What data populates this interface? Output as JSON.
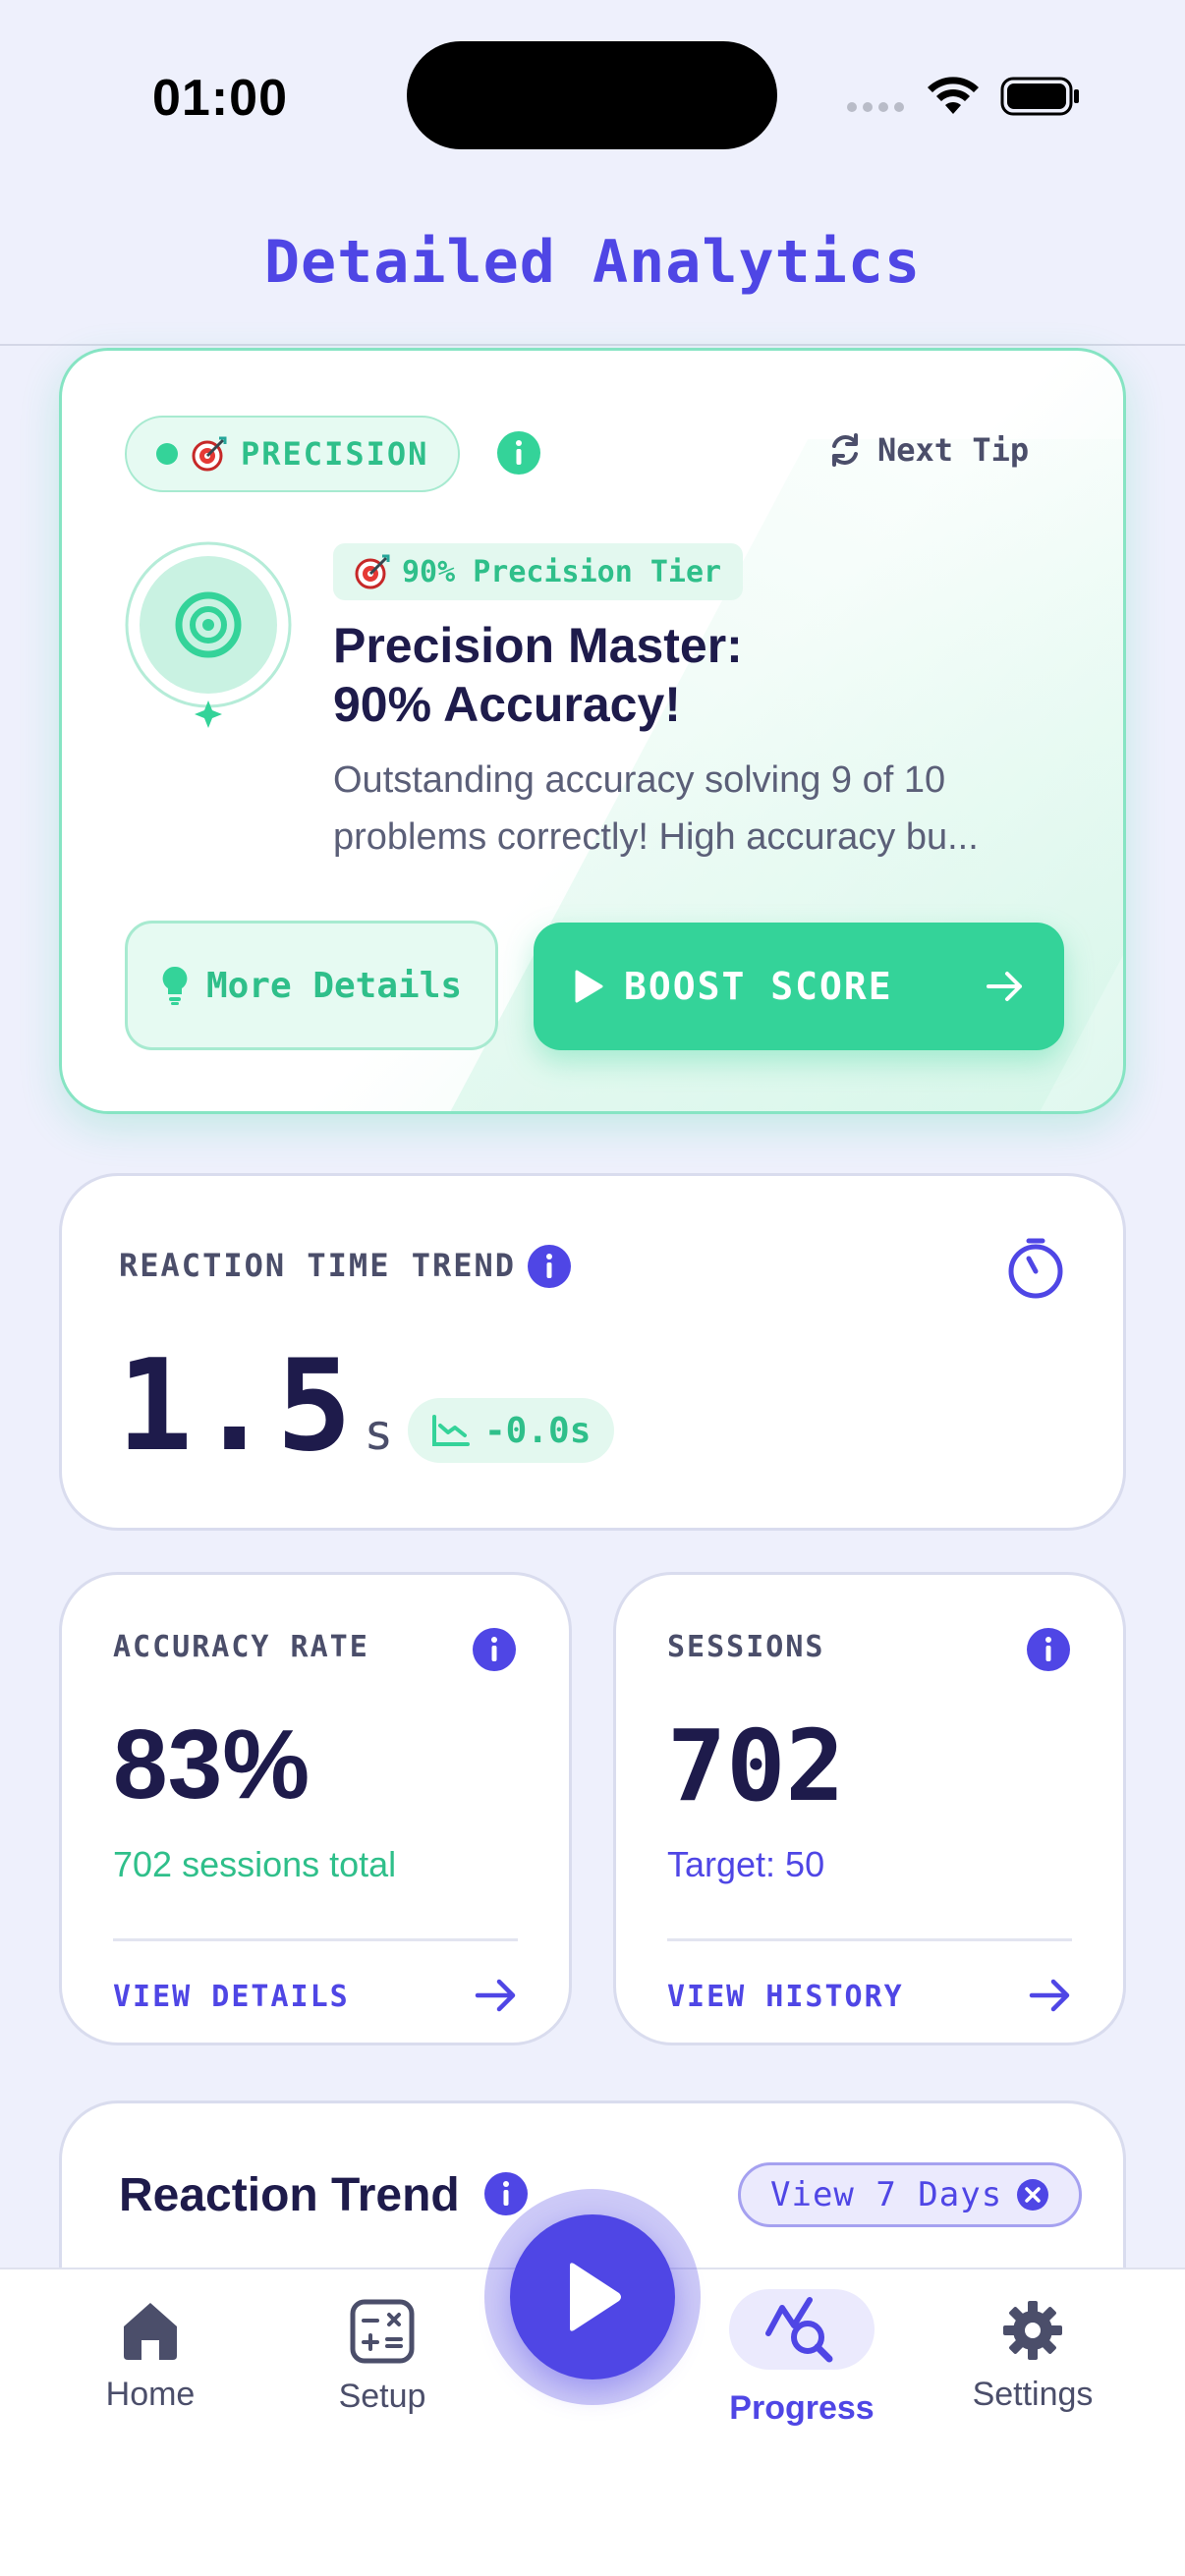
{
  "status_bar": {
    "time": "01:00"
  },
  "header": {
    "title": "Detailed Analytics"
  },
  "tip_card": {
    "category": "PRECISION",
    "next_tip": "Next Tip",
    "tier": "90% Precision Tier",
    "title_line1": "Precision Master:",
    "title_line2": "90% Accuracy!",
    "desc_line1": "Outstanding accuracy solving 9 of 10",
    "desc_line2": "problems correctly! High accuracy bu...",
    "more_details": "More Details",
    "boost_score": "BOOST SCORE"
  },
  "reaction_card": {
    "label": "REACTION TIME TREND",
    "value": "1.5",
    "unit": "s",
    "delta": "-0.0s"
  },
  "accuracy_card": {
    "label": "ACCURACY RATE",
    "value": "83%",
    "sub": "702 sessions total",
    "link": "VIEW DETAILS"
  },
  "sessions_card": {
    "label": "SESSIONS",
    "value": "702",
    "sub": "Target: 50",
    "link": "VIEW HISTORY"
  },
  "trend_card": {
    "title": "Reaction Trend",
    "filter": "View 7 Days"
  },
  "tabs": [
    {
      "label": "Home",
      "icon": "home-icon"
    },
    {
      "label": "Setup",
      "icon": "calculator-icon"
    },
    {
      "label": "Progress",
      "icon": "analytics-icon",
      "active": true
    },
    {
      "label": "Settings",
      "icon": "gear-icon"
    }
  ],
  "colors": {
    "accent": "#4f46e5",
    "success": "#34d399",
    "background": "#eef0fc"
  }
}
